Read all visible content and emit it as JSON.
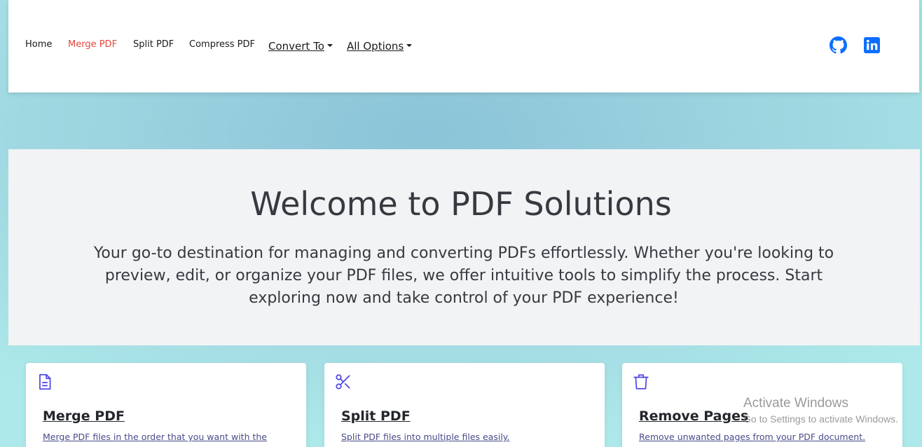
{
  "nav": {
    "links": [
      "Home",
      "Merge PDF",
      "Split PDF",
      "Compress PDF"
    ],
    "active": "Merge PDF",
    "dropdowns": [
      "Convert To",
      "All Options"
    ],
    "social": [
      "github-icon",
      "linkedin-icon"
    ],
    "accent_color": "#e5483f",
    "social_color": "#0d6efd"
  },
  "hero": {
    "title": "Welcome to PDF Solutions",
    "description": "Your go-to destination for managing and converting PDFs effortlessly. Whether you're looking to preview, edit, or organize your PDF files, we offer intuitive tools to simplify the process. Start exploring now and take control of your PDF experience!"
  },
  "cards": [
    {
      "icon": "document-icon",
      "title": "Merge PDF",
      "description": "Merge PDF files in the order that you want with the"
    },
    {
      "icon": "scissors-icon",
      "title": "Split PDF",
      "description": "Split PDF files into multiple files easily."
    },
    {
      "icon": "trash-icon",
      "title": "Remove Pages",
      "description": "Remove unwanted pages from your PDF document."
    }
  ],
  "card_icon_color": "#4f46e5",
  "watermark": {
    "title": "Activate Windows",
    "subtitle": "Go to Settings to activate Windows."
  }
}
